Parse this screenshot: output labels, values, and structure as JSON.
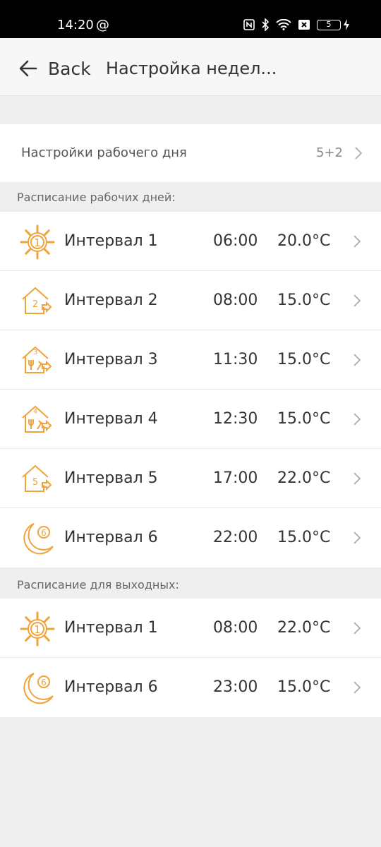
{
  "status": {
    "time": "14:20",
    "at_symbol": "@",
    "battery": "5"
  },
  "header": {
    "back_label": "Back",
    "title": "Настройка недел..."
  },
  "workday": {
    "label": "Настройки рабочего дня",
    "value": "5+2"
  },
  "workdays_section": {
    "title": "Расписание рабочих дней:",
    "rows": [
      {
        "icon": "sun-icon",
        "icon_number": "1",
        "name": "Интервал 1",
        "time": "06:00",
        "temp": "20.0°C"
      },
      {
        "icon": "house-leave-icon",
        "icon_number": "2",
        "name": "Интервал 2",
        "time": "08:00",
        "temp": "15.0°C"
      },
      {
        "icon": "house-lunch-icon",
        "icon_number": "3",
        "name": "Интервал 3",
        "time": "11:30",
        "temp": "15.0°C"
      },
      {
        "icon": "house-lunch-icon",
        "icon_number": "4",
        "name": "Интервал 4",
        "time": "12:30",
        "temp": "15.0°C"
      },
      {
        "icon": "house-return-icon",
        "icon_number": "5",
        "name": "Интервал 5",
        "time": "17:00",
        "temp": "22.0°C"
      },
      {
        "icon": "moon-icon",
        "icon_number": "6",
        "name": "Интервал 6",
        "time": "22:00",
        "temp": "15.0°C"
      }
    ]
  },
  "weekend_section": {
    "title": "Расписание для выходных:",
    "rows": [
      {
        "icon": "sun-icon",
        "icon_number": "1",
        "name": "Интервал 1",
        "time": "08:00",
        "temp": "22.0°C"
      },
      {
        "icon": "moon-icon",
        "icon_number": "6",
        "name": "Интервал 6",
        "time": "23:00",
        "temp": "15.0°C"
      }
    ]
  },
  "colors": {
    "accent": "#f0a33a",
    "background": "#efefef",
    "status_bar": "#000000"
  }
}
